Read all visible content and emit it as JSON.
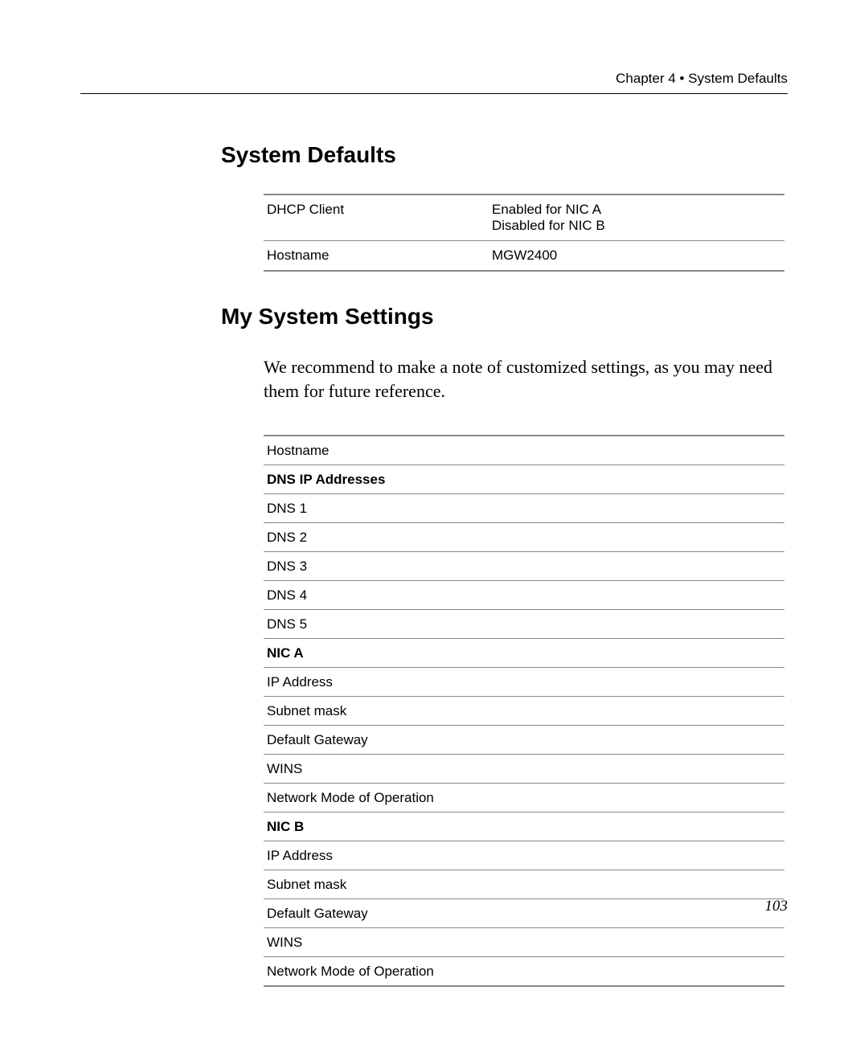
{
  "header": {
    "chapter": "Chapter 4",
    "bullet": "•",
    "title": "System Defaults"
  },
  "heading1": "System Defaults",
  "defaults": [
    {
      "label": "DHCP Client",
      "value_line1": "Enabled for NIC A",
      "value_line2": "Disabled for NIC B"
    },
    {
      "label": "Hostname",
      "value_line1": "MGW2400",
      "value_line2": ""
    }
  ],
  "heading2": "My System Settings",
  "body_text": "We recommend to make a note of customized settings, as you may need them for future reference.",
  "settings_rows": [
    {
      "label": "Hostname",
      "header": false
    },
    {
      "label": "DNS IP Addresses",
      "header": true
    },
    {
      "label": "DNS 1",
      "header": false
    },
    {
      "label": "DNS 2",
      "header": false
    },
    {
      "label": "DNS 3",
      "header": false
    },
    {
      "label": "DNS 4",
      "header": false
    },
    {
      "label": "DNS 5",
      "header": false
    },
    {
      "label": "NIC A",
      "header": true
    },
    {
      "label": "IP Address",
      "header": false
    },
    {
      "label": "Subnet mask",
      "header": false
    },
    {
      "label": "Default Gateway",
      "header": false
    },
    {
      "label": "WINS",
      "header": false
    },
    {
      "label": "Network Mode of Operation",
      "header": false
    },
    {
      "label": "NIC B",
      "header": true
    },
    {
      "label": "IP Address",
      "header": false
    },
    {
      "label": "Subnet mask",
      "header": false
    },
    {
      "label": "Default Gateway",
      "header": false
    },
    {
      "label": "WINS",
      "header": false
    },
    {
      "label": "Network Mode of Operation",
      "header": false
    }
  ],
  "page_number": "103"
}
